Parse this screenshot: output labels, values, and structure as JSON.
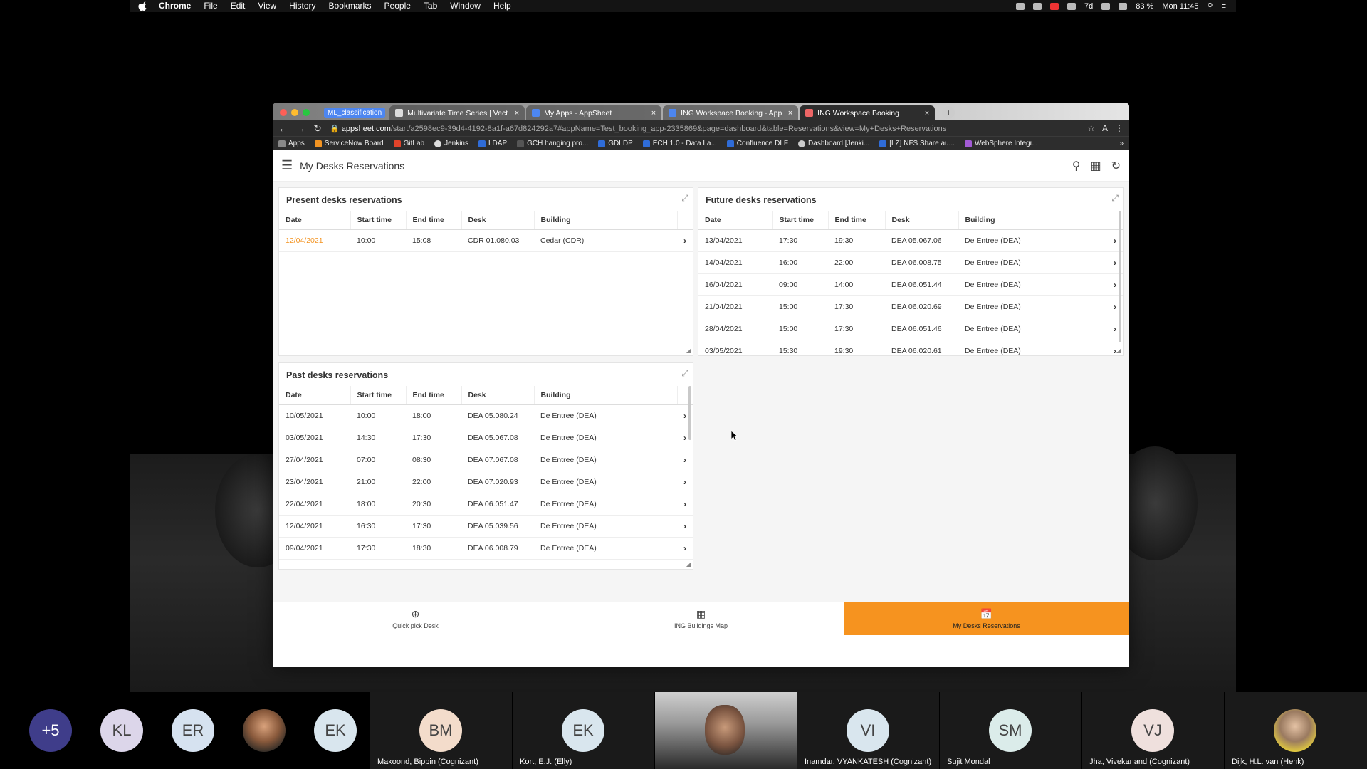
{
  "menubar": {
    "app": "Chrome",
    "items": [
      "File",
      "Edit",
      "View",
      "History",
      "Bookmarks",
      "People",
      "Tab",
      "Window",
      "Help"
    ],
    "battery": "83 %",
    "clock": "Mon 11:45",
    "temp": "7d"
  },
  "browser": {
    "tab_group_label": "ML_classification",
    "tabs": [
      {
        "title": "Multivariate Time Series | Vect"
      },
      {
        "title": "My Apps - AppSheet"
      },
      {
        "title": "ING Workspace Booking - App"
      },
      {
        "title": "ING Workspace Booking"
      }
    ],
    "url_domain": "appsheet.com",
    "url_path": "/start/a2598ec9-39d4-4192-8a1f-a67d824292a7#appName=Test_booking_app-2335869&page=dashboard&table=Reservations&view=My+Desks+Reservations",
    "bookmarks": [
      "Apps",
      "ServiceNow Board",
      "GitLab",
      "Jenkins",
      "LDAP",
      "GCH hanging pro...",
      "GDLDP",
      "ECH 1.0 - Data La...",
      "Confluence DLF",
      "Dashboard [Jenki...",
      "[LZ] NFS Share au...",
      "WebSphere Integr..."
    ]
  },
  "app": {
    "title": "My Desks Reservations",
    "columns": [
      "Date",
      "Start time",
      "End time",
      "Desk",
      "Building"
    ],
    "present": {
      "title": "Present desks reservations",
      "rows": [
        [
          "12/04/2021",
          "10:00",
          "15:08",
          "CDR 01.080.03",
          "Cedar (CDR)"
        ]
      ]
    },
    "future": {
      "title": "Future desks reservations",
      "rows": [
        [
          "13/04/2021",
          "17:30",
          "19:30",
          "DEA 05.067.06",
          "De Entree (DEA)"
        ],
        [
          "14/04/2021",
          "16:00",
          "22:00",
          "DEA 06.008.75",
          "De Entree (DEA)"
        ],
        [
          "16/04/2021",
          "09:00",
          "14:00",
          "DEA 06.051.44",
          "De Entree (DEA)"
        ],
        [
          "21/04/2021",
          "15:00",
          "17:30",
          "DEA 06.020.69",
          "De Entree (DEA)"
        ],
        [
          "28/04/2021",
          "15:00",
          "17:30",
          "DEA 06.051.46",
          "De Entree (DEA)"
        ],
        [
          "03/05/2021",
          "15:30",
          "19:30",
          "DEA 06.020.61",
          "De Entree (DEA)"
        ]
      ]
    },
    "past": {
      "title": "Past desks reservations",
      "rows": [
        [
          "10/05/2021",
          "10:00",
          "18:00",
          "DEA 05.080.24",
          "De Entree (DEA)"
        ],
        [
          "03/05/2021",
          "14:30",
          "17:30",
          "DEA 05.067.08",
          "De Entree (DEA)"
        ],
        [
          "27/04/2021",
          "07:00",
          "08:30",
          "DEA 07.067.08",
          "De Entree (DEA)"
        ],
        [
          "23/04/2021",
          "21:00",
          "22:00",
          "DEA 07.020.93",
          "De Entree (DEA)"
        ],
        [
          "22/04/2021",
          "18:00",
          "20:30",
          "DEA 06.051.47",
          "De Entree (DEA)"
        ],
        [
          "12/04/2021",
          "16:30",
          "17:30",
          "DEA 05.039.56",
          "De Entree (DEA)"
        ],
        [
          "09/04/2021",
          "17:30",
          "18:30",
          "DEA 06.008.79",
          "De Entree (DEA)"
        ]
      ]
    },
    "bottom_nav": [
      {
        "label": "Quick pick Desk",
        "icon": "crosshair-icon"
      },
      {
        "label": "ING Buildings Map",
        "icon": "building-icon"
      },
      {
        "label": "My Desks Reservations",
        "icon": "calendar-check-icon"
      }
    ],
    "accent": "#f6931f"
  },
  "participants": [
    {
      "initials": "+5",
      "name": ""
    },
    {
      "initials": "KL",
      "name": ""
    },
    {
      "initials": "ER",
      "name": ""
    },
    {
      "initials": "",
      "name": ""
    },
    {
      "initials": "EK",
      "name": ""
    },
    {
      "initials": "BM",
      "name": "Makoond, Bippin (Cognizant)"
    },
    {
      "initials": "EK",
      "name": "Kort, E.J. (Elly)"
    },
    {
      "initials": "",
      "name": ""
    },
    {
      "initials": "VI",
      "name": "Inamdar, VYANKATESH (Cognizant)"
    },
    {
      "initials": "SM",
      "name": "Sujit Mondal"
    },
    {
      "initials": "VJ",
      "name": "Jha, Vivekanand (Cognizant)"
    },
    {
      "initials": "",
      "name": "Dijk, H.L. van (Henk)"
    }
  ]
}
